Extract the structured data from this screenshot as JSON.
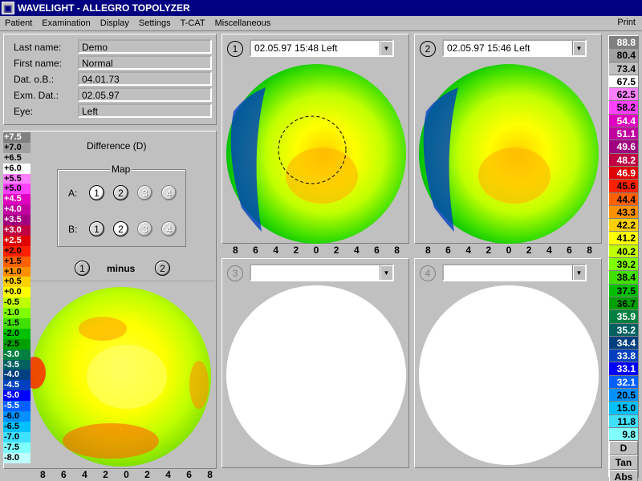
{
  "window": {
    "title": "WAVELIGHT - ALLEGRO TOPOLYZER"
  },
  "menu": {
    "items": [
      "Patient",
      "Examination",
      "Display",
      "Settings",
      "T-CAT",
      "Miscellaneous"
    ],
    "print": "Print"
  },
  "patient": {
    "fields": [
      {
        "label": "Last name:",
        "value": "Demo"
      },
      {
        "label": "First name:",
        "value": "Normal"
      },
      {
        "label": "Dat. o.B.:",
        "value": "04.01.73"
      },
      {
        "label": "Exm. Dat.:",
        "value": "02.05.97"
      },
      {
        "label": "Eye:",
        "value": "Left"
      }
    ]
  },
  "difference": {
    "title": "Difference (D)",
    "map_label": "Map",
    "row_a": "A:",
    "row_b": "B:",
    "buttons": [
      "1",
      "2",
      "3",
      "4"
    ],
    "minus_label": "minus",
    "left_num": "1",
    "right_num": "2"
  },
  "left_scale": [
    "+7.5",
    "+7.0",
    "+6.5",
    "+6.0",
    "+5.5",
    "+5.0",
    "+4.5",
    "+4.0",
    "+3.5",
    "+3.0",
    "+2.5",
    "+2.0",
    "+1.5",
    "+1.0",
    "+0.5",
    "+0.0",
    "-0.5",
    "-1.0",
    "-1.5",
    "-2.0",
    "-2.5",
    "-3.0",
    "-3.5",
    "-4.0",
    "-4.5",
    "-5.0",
    "-5.5",
    "-6.0",
    "-6.5",
    "-7.0",
    "-7.5",
    "-8.0"
  ],
  "left_scale_colors": [
    "#808080",
    "#a0a0a0",
    "#c0c0c0",
    "#ffffff",
    "#ff80ff",
    "#ff40ff",
    "#e000c0",
    "#c000a0",
    "#a00080",
    "#c00040",
    "#e00000",
    "#ff2000",
    "#ff6000",
    "#ff9000",
    "#ffd000",
    "#ffff00",
    "#c0ff00",
    "#80ff00",
    "#40e000",
    "#00c000",
    "#00a000",
    "#008040",
    "#006060",
    "#004080",
    "#0040c0",
    "#0000ff",
    "#0060ff",
    "#0090ff",
    "#00c0ff",
    "#40e0ff",
    "#80ffff",
    "#c0ffff"
  ],
  "axis_ticks": [
    "8",
    "6",
    "4",
    "2",
    "0",
    "2",
    "4",
    "6",
    "8"
  ],
  "panels": [
    {
      "num": "1",
      "value": "02.05.97  15:48 Left"
    },
    {
      "num": "2",
      "value": "02.05.97  15:46 Left"
    },
    {
      "num": "3",
      "value": ""
    },
    {
      "num": "4",
      "value": ""
    }
  ],
  "right_scale": [
    "88.8",
    "80.4",
    "73.4",
    "67.5",
    "62.5",
    "58.2",
    "54.4",
    "51.1",
    "49.6",
    "48.2",
    "46.9",
    "45.6",
    "44.4",
    "43.3",
    "42.2",
    "41.2",
    "40.2",
    "39.2",
    "38.4",
    "37.5",
    "36.7",
    "35.9",
    "35.2",
    "34.4",
    "33.8",
    "33.1",
    "32.1",
    "20.5",
    "15.0",
    "11.8",
    "9.8"
  ],
  "right_scale_colors": [
    "#808080",
    "#a0a0a0",
    "#c0c0c0",
    "#ffffff",
    "#ff80ff",
    "#ff40ff",
    "#e000c0",
    "#c000a0",
    "#a00080",
    "#c00040",
    "#e00000",
    "#ff2000",
    "#ff6000",
    "#ff9000",
    "#ffd000",
    "#ffff00",
    "#c0ff00",
    "#80ff00",
    "#40e000",
    "#00c000",
    "#00a000",
    "#008040",
    "#006060",
    "#004080",
    "#0040c0",
    "#0000ff",
    "#0060ff",
    "#0090ff",
    "#00c0ff",
    "#40e0ff",
    "#80ffff"
  ],
  "right_buttons": [
    "D",
    "Tan",
    "Abs"
  ]
}
